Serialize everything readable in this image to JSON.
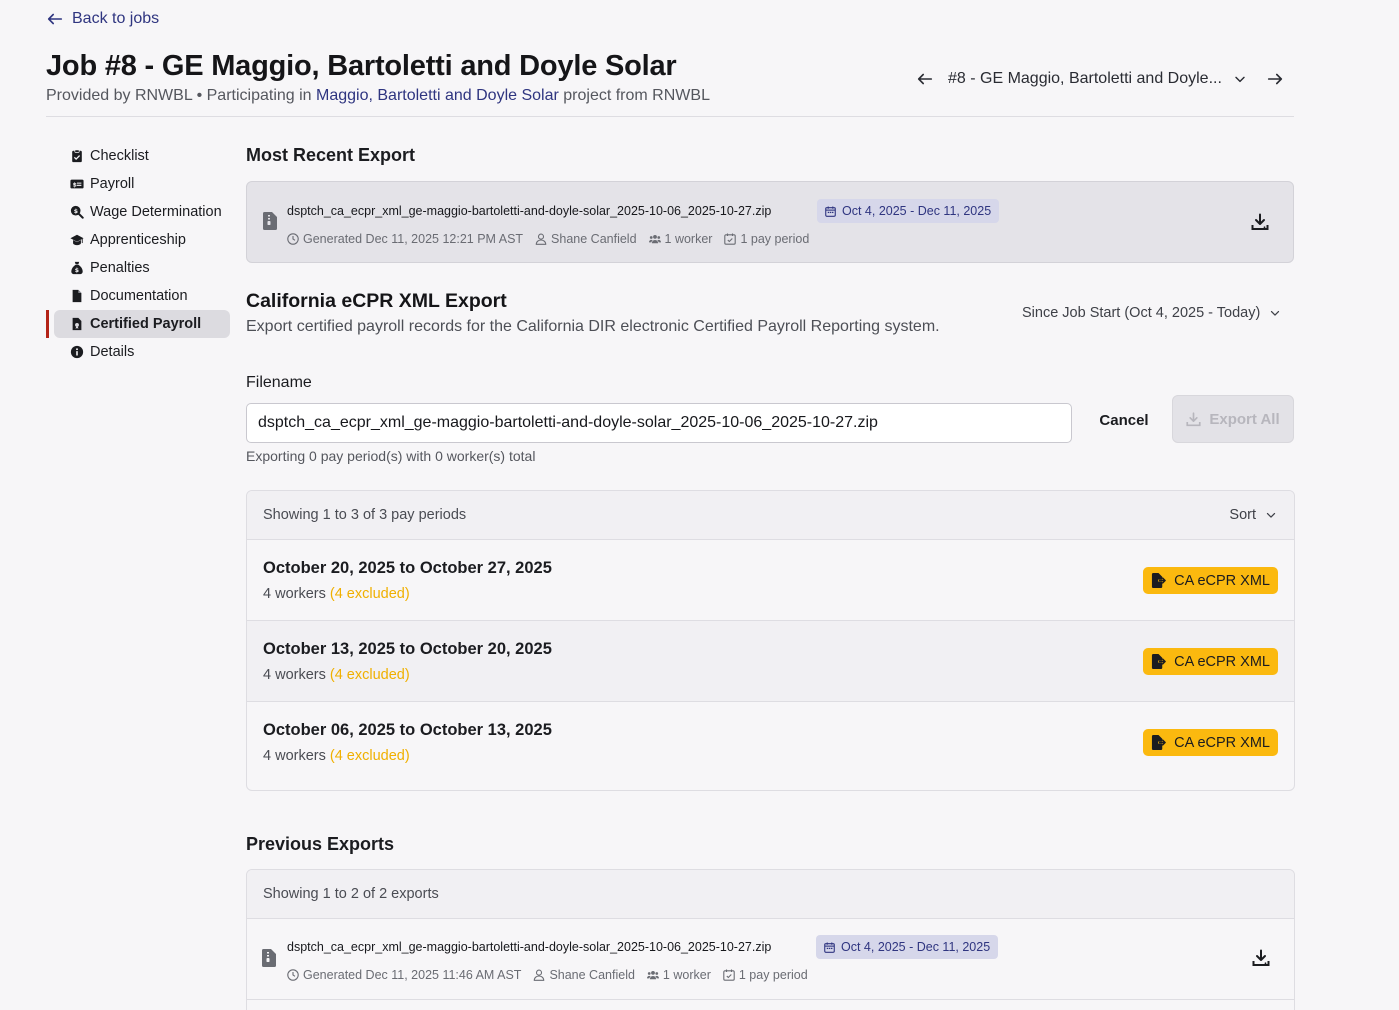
{
  "back_link": {
    "label": "Back to jobs"
  },
  "header": {
    "title": "Job #8 - GE Maggio, Bartoletti and Doyle Solar",
    "provided_by": "Provided by RNWBL • Participating in",
    "project_link": "Maggio, Bartoletti and Doyle Solar",
    "project_suffix": "project from RNWBL",
    "job_select": "#8 - GE Maggio, Bartoletti and Doyle..."
  },
  "sidebar": {
    "items": [
      {
        "label": "Checklist",
        "icon": "clipboard-check-icon"
      },
      {
        "label": "Payroll",
        "icon": "money-bill-icon"
      },
      {
        "label": "Wage Determination",
        "icon": "search-dollar-icon"
      },
      {
        "label": "Apprenticeship",
        "icon": "graduation-cap-icon"
      },
      {
        "label": "Penalties",
        "icon": "money-bag-icon"
      },
      {
        "label": "Documentation",
        "icon": "file-icon"
      },
      {
        "label": "Certified Payroll",
        "icon": "file-certificate-icon",
        "active": true
      },
      {
        "label": "Details",
        "icon": "info-circle-icon"
      }
    ]
  },
  "most_recent": {
    "title": "Most Recent Export",
    "file_name": "dsptch_ca_ecpr_xml_ge-maggio-bartoletti-and-doyle-solar_2025-10-06_2025-10-27.zip",
    "date_range": "Oct 4, 2025 - Dec 11, 2025",
    "generated": "Generated Dec 11, 2025 12:21 PM AST",
    "user": "Shane Canfield",
    "workers": "1 worker",
    "periods": "1 pay period"
  },
  "ecpr": {
    "title": "California eCPR XML Export",
    "description": "Export certified payroll records for the California DIR electronic Certified Payroll Reporting system.",
    "range_select": "Since Job Start (Oct 4, 2025 - Today)",
    "filename_label": "Filename",
    "filename_value": "dsptch_ca_ecpr_xml_ge-maggio-bartoletti-and-doyle-solar_2025-10-06_2025-10-27.zip",
    "cancel_label": "Cancel",
    "export_all_label": "Export All",
    "exporting_note": "Exporting 0 pay period(s) with 0 worker(s) total"
  },
  "pay_periods": {
    "showing": "Showing 1 to 3 of 3 pay periods",
    "sort_label": "Sort",
    "rows": [
      {
        "title": "October 20, 2025 to October 27, 2025",
        "workers": "4 workers",
        "excluded": "(4 excluded)",
        "button": "CA eCPR XML"
      },
      {
        "title": "October 13, 2025 to October 20, 2025",
        "workers": "4 workers",
        "excluded": "(4 excluded)",
        "button": "CA eCPR XML"
      },
      {
        "title": "October 06, 2025 to October 13, 2025",
        "workers": "4 workers",
        "excluded": "(4 excluded)",
        "button": "CA eCPR XML"
      }
    ]
  },
  "previous": {
    "title": "Previous Exports",
    "showing": "Showing 1 to 2 of 2 exports",
    "rows": [
      {
        "file_name": "dsptch_ca_ecpr_xml_ge-maggio-bartoletti-and-doyle-solar_2025-10-06_2025-10-27.zip",
        "date_range": "Oct 4, 2025 - Dec 11, 2025",
        "generated": "Generated Dec 11, 2025 11:46 AM AST",
        "user": "Shane Canfield",
        "workers": "1 worker",
        "periods": "1 pay period"
      }
    ]
  },
  "colors": {
    "link": "#2f3580",
    "active_marker": "#b42318",
    "ecpr_button": "#fbb90f",
    "excluded_text": "#f0b000",
    "date_pill_bg": "#d6d7ea"
  }
}
